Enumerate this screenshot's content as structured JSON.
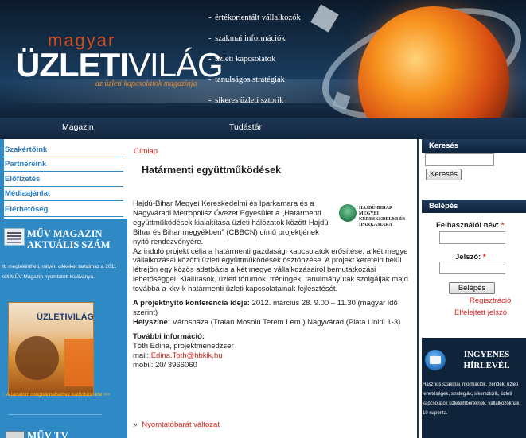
{
  "header": {
    "logo_small": "magyar",
    "logo_big_bold": "ÜZLETI",
    "logo_big_thin": "VILÁG",
    "logo_tagline": "az üzleti kapcsolatok magazinja",
    "taglines": [
      "értékorientált vállalkozók",
      "szakmai információk",
      "üzleti kapcsolatok",
      "tanulságos stratégiák",
      "sikeres üzleti sztorik"
    ]
  },
  "topnav": {
    "items": [
      "Magazin",
      "Tudástár"
    ]
  },
  "left_menu": {
    "items": [
      "Szakértőink",
      "Partnereink",
      "Előfizetés",
      "Médiaajánlat",
      "Elérhetőség"
    ]
  },
  "left_promo": {
    "title": "MŰV MAGAZIN AKTUÁLIS SZÁM",
    "text": "Itt megtekintheti, milyen cikkeket tartalmaz a 2011 téli MŰV Magazin nyomtatott kiadványa.",
    "cover_logo": "ÜZLETIVILÁG",
    "link": ":: A tartalom megtekintéséhez kattintson ide >>",
    "tv_title": "MŰV TV"
  },
  "main": {
    "breadcrumb": "Címlap",
    "title": "Határmenti együttműködések",
    "art_logo_text": "HAJDÚ-BIHAR MEGYEI KERESKEDELMI ÉS IPARKAMARA",
    "p1": "Hajdú-Bihar Megyei Kereskedelmi és Iparkamara és a Nagyváradi Metropolisz Övezet Egyesület a „Határmenti együttműködések kialakítása üzleti hálózatok között Hajdú-Bihar és Bihar megyékben” (CBBCN) című projektjének nyitó rendezvényére.",
    "p2": "Az induló projekt célja a határmenti gazdasági kapcsolatok erősítése, a két megye vállalkozásai közötti üzleti együttműködések ösztönzése.  A projekt keretein belül létrejön egy közös adatbázis a két megye vállalkozásairól bemutatkozási lehetőséggel.  Kiállítások, üzleti fórumok, tréningek, tanulmányutak szolgálják majd továbbá a kkv-k határmenti üzleti kapcsolatainak fejlesztését.",
    "conf_label": "A projektnyitó konferencia ideje:",
    "conf_value": " 2012. március 28.  9.00 – 11.30 (magyar idő szerint)",
    "venue_label": "Helyszíne:",
    "venue_value": " Városháza (Traian Mosoiu Terem I.em.) Nagyvárad (Piata Unirii 1-3)",
    "info_label": "További információ:",
    "contact_name": "Tóth Edina, projektmenedzser",
    "mail_label": "mail: ",
    "mail_value": "Edina.Toth@hbkik.hu",
    "mobile": "mobil: 20/ 3966060",
    "print_arrow": "»",
    "print_link": "Nyomtatóbarát változat"
  },
  "right": {
    "search_head": "Keresés",
    "search_button": "Keresés",
    "login_head": "Belépés",
    "username_label": "Felhasználói név:",
    "password_label": "Jelszó:",
    "required_mark": "*",
    "login_button": "Belépés",
    "register_link": "Regisztráció",
    "forgot_link": "Elfelejtett jelszó",
    "newsletter_title": "INGYENES HÍRLEVÉL",
    "newsletter_text": "Hasznos szakmai információk, trendek, üzleti lehetőségek, stratégiák, sikersztorik, üzleti kapcsolatok üzletembereknek, vállalkozóknak 10 naponta."
  }
}
